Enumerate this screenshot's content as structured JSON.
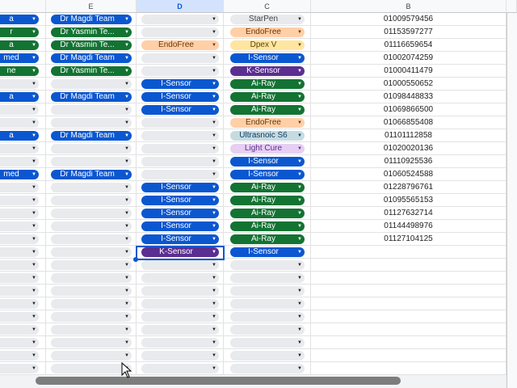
{
  "columns": {
    "E": "E",
    "D": "D",
    "C": "C",
    "B": "B"
  },
  "colors": {
    "blue": "#0b57d0",
    "green": "#137333",
    "purple": "#5b2e91",
    "light_purple": "#e6cff2",
    "orange": "#ffcfa8",
    "light_blue": "#c6dbe1",
    "gray": "#e8eaed",
    "yellow": "#ffe5a0"
  },
  "rows": [
    {
      "f": {
        "t": "a",
        "c": "blue"
      },
      "e": {
        "t": "Dr Magdi Team",
        "c": "blue"
      },
      "d": {
        "t": "",
        "c": "gray"
      },
      "c": {
        "t": "StarPen",
        "c": "gray"
      },
      "b": "01009579456"
    },
    {
      "f": {
        "t": "r",
        "c": "green"
      },
      "e": {
        "t": "Dr Yasmin Te...",
        "c": "green"
      },
      "d": {
        "t": "",
        "c": "gray"
      },
      "c": {
        "t": "EndoFree",
        "c": "orange"
      },
      "b": "01153597277"
    },
    {
      "f": {
        "t": "a",
        "c": "green"
      },
      "e": {
        "t": "Dr Yasmin Te...",
        "c": "green"
      },
      "d": {
        "t": "EndoFree",
        "c": "orange"
      },
      "c": {
        "t": "Dpex V",
        "c": "yellow"
      },
      "b": "01116659654"
    },
    {
      "f": {
        "t": "med",
        "c": "blue"
      },
      "e": {
        "t": "Dr Magdi Team",
        "c": "blue"
      },
      "d": {
        "t": "",
        "c": "gray"
      },
      "c": {
        "t": "I-Sensor",
        "c": "blue"
      },
      "b": "01002074259"
    },
    {
      "f": {
        "t": "ne",
        "c": "green"
      },
      "e": {
        "t": "Dr Yasmin Te...",
        "c": "green"
      },
      "d": {
        "t": "",
        "c": "gray"
      },
      "c": {
        "t": "K-Sensor",
        "c": "purple"
      },
      "b": "01000411479"
    },
    {
      "f": {
        "t": "",
        "c": "gray"
      },
      "e": {
        "t": "",
        "c": "gray"
      },
      "d": {
        "t": "I-Sensor",
        "c": "blue"
      },
      "c": {
        "t": "Ai-Ray",
        "c": "green"
      },
      "b": "01000550652"
    },
    {
      "f": {
        "t": "a",
        "c": "blue"
      },
      "e": {
        "t": "Dr Magdi Team",
        "c": "blue"
      },
      "d": {
        "t": "I-Sensor",
        "c": "blue"
      },
      "c": {
        "t": "Ai-Ray",
        "c": "green"
      },
      "b": "01098448833"
    },
    {
      "f": {
        "t": "",
        "c": "gray"
      },
      "e": {
        "t": "",
        "c": "gray"
      },
      "d": {
        "t": "I-Sensor",
        "c": "blue"
      },
      "c": {
        "t": "Ai-Ray",
        "c": "green"
      },
      "b": "01069866500"
    },
    {
      "f": {
        "t": "",
        "c": "gray"
      },
      "e": {
        "t": "",
        "c": "gray"
      },
      "d": {
        "t": "",
        "c": "gray"
      },
      "c": {
        "t": "EndoFree",
        "c": "orange"
      },
      "b": "01066855408"
    },
    {
      "f": {
        "t": "a",
        "c": "blue"
      },
      "e": {
        "t": "Dr Magdi Team",
        "c": "blue"
      },
      "d": {
        "t": "",
        "c": "gray"
      },
      "c": {
        "t": "Ultrasnoic S6",
        "c": "light_blue"
      },
      "b": "01101112858"
    },
    {
      "f": {
        "t": "",
        "c": "gray"
      },
      "e": {
        "t": "",
        "c": "gray"
      },
      "d": {
        "t": "",
        "c": "gray"
      },
      "c": {
        "t": "Light Cure",
        "c": "light_purple"
      },
      "b": "01020020136"
    },
    {
      "f": {
        "t": "",
        "c": "gray"
      },
      "e": {
        "t": "",
        "c": "gray"
      },
      "d": {
        "t": "",
        "c": "gray"
      },
      "c": {
        "t": "I-Sensor",
        "c": "blue"
      },
      "b": "01110925536"
    },
    {
      "f": {
        "t": "med",
        "c": "blue"
      },
      "e": {
        "t": "Dr Magdi Team",
        "c": "blue"
      },
      "d": {
        "t": "",
        "c": "gray"
      },
      "c": {
        "t": "I-Sensor",
        "c": "blue"
      },
      "b": "01060524588"
    },
    {
      "f": {
        "t": "",
        "c": "gray"
      },
      "e": {
        "t": "",
        "c": "gray"
      },
      "d": {
        "t": "I-Sensor",
        "c": "blue"
      },
      "c": {
        "t": "Ai-Ray",
        "c": "green"
      },
      "b": "01228796761"
    },
    {
      "f": {
        "t": "",
        "c": "gray"
      },
      "e": {
        "t": "",
        "c": "gray"
      },
      "d": {
        "t": "I-Sensor",
        "c": "blue"
      },
      "c": {
        "t": "Ai-Ray",
        "c": "green"
      },
      "b": "01095565153"
    },
    {
      "f": {
        "t": "",
        "c": "gray"
      },
      "e": {
        "t": "",
        "c": "gray"
      },
      "d": {
        "t": "I-Sensor",
        "c": "blue"
      },
      "c": {
        "t": "Ai-Ray",
        "c": "green"
      },
      "b": "01127632714"
    },
    {
      "f": {
        "t": "",
        "c": "gray"
      },
      "e": {
        "t": "",
        "c": "gray"
      },
      "d": {
        "t": "I-Sensor",
        "c": "blue"
      },
      "c": {
        "t": "Ai-Ray",
        "c": "green"
      },
      "b": "01144498976"
    },
    {
      "f": {
        "t": "",
        "c": "gray"
      },
      "e": {
        "t": "",
        "c": "gray"
      },
      "d": {
        "t": "I-Sensor",
        "c": "blue"
      },
      "c": {
        "t": "Ai-Ray",
        "c": "green"
      },
      "b": "01127104125"
    },
    {
      "f": {
        "t": "",
        "c": "gray"
      },
      "e": {
        "t": "",
        "c": "gray"
      },
      "d": {
        "t": "K-Sensor",
        "c": "purple"
      },
      "c": {
        "t": "I-Sensor",
        "c": "blue"
      },
      "b": ""
    },
    {
      "f": {
        "t": "",
        "c": "gray"
      },
      "e": {
        "t": "",
        "c": "gray"
      },
      "d": {
        "t": "",
        "c": "gray"
      },
      "c": {
        "t": "",
        "c": "gray"
      },
      "b": ""
    },
    {
      "f": {
        "t": "",
        "c": "gray"
      },
      "e": {
        "t": "",
        "c": "gray"
      },
      "d": {
        "t": "",
        "c": "gray"
      },
      "c": {
        "t": "",
        "c": "gray"
      },
      "b": ""
    },
    {
      "f": {
        "t": "",
        "c": "gray"
      },
      "e": {
        "t": "",
        "c": "gray"
      },
      "d": {
        "t": "",
        "c": "gray"
      },
      "c": {
        "t": "",
        "c": "gray"
      },
      "b": ""
    },
    {
      "f": {
        "t": "",
        "c": "gray"
      },
      "e": {
        "t": "",
        "c": "gray"
      },
      "d": {
        "t": "",
        "c": "gray"
      },
      "c": {
        "t": "",
        "c": "gray"
      },
      "b": ""
    },
    {
      "f": {
        "t": "",
        "c": "gray"
      },
      "e": {
        "t": "",
        "c": "gray"
      },
      "d": {
        "t": "",
        "c": "gray"
      },
      "c": {
        "t": "",
        "c": "gray"
      },
      "b": ""
    },
    {
      "f": {
        "t": "",
        "c": "gray"
      },
      "e": {
        "t": "",
        "c": "gray"
      },
      "d": {
        "t": "",
        "c": "gray"
      },
      "c": {
        "t": "",
        "c": "gray"
      },
      "b": ""
    },
    {
      "f": {
        "t": "",
        "c": "gray"
      },
      "e": {
        "t": "",
        "c": "gray"
      },
      "d": {
        "t": "",
        "c": "gray"
      },
      "c": {
        "t": "",
        "c": "gray"
      },
      "b": ""
    },
    {
      "f": {
        "t": "",
        "c": "gray"
      },
      "e": {
        "t": "",
        "c": "gray"
      },
      "d": {
        "t": "",
        "c": "gray"
      },
      "c": {
        "t": "",
        "c": "gray"
      },
      "b": ""
    },
    {
      "f": {
        "t": "",
        "c": "gray"
      },
      "e": {
        "t": "",
        "c": "gray"
      },
      "d": {
        "t": "",
        "c": "gray"
      },
      "c": {
        "t": "",
        "c": "gray"
      },
      "b": ""
    }
  ]
}
